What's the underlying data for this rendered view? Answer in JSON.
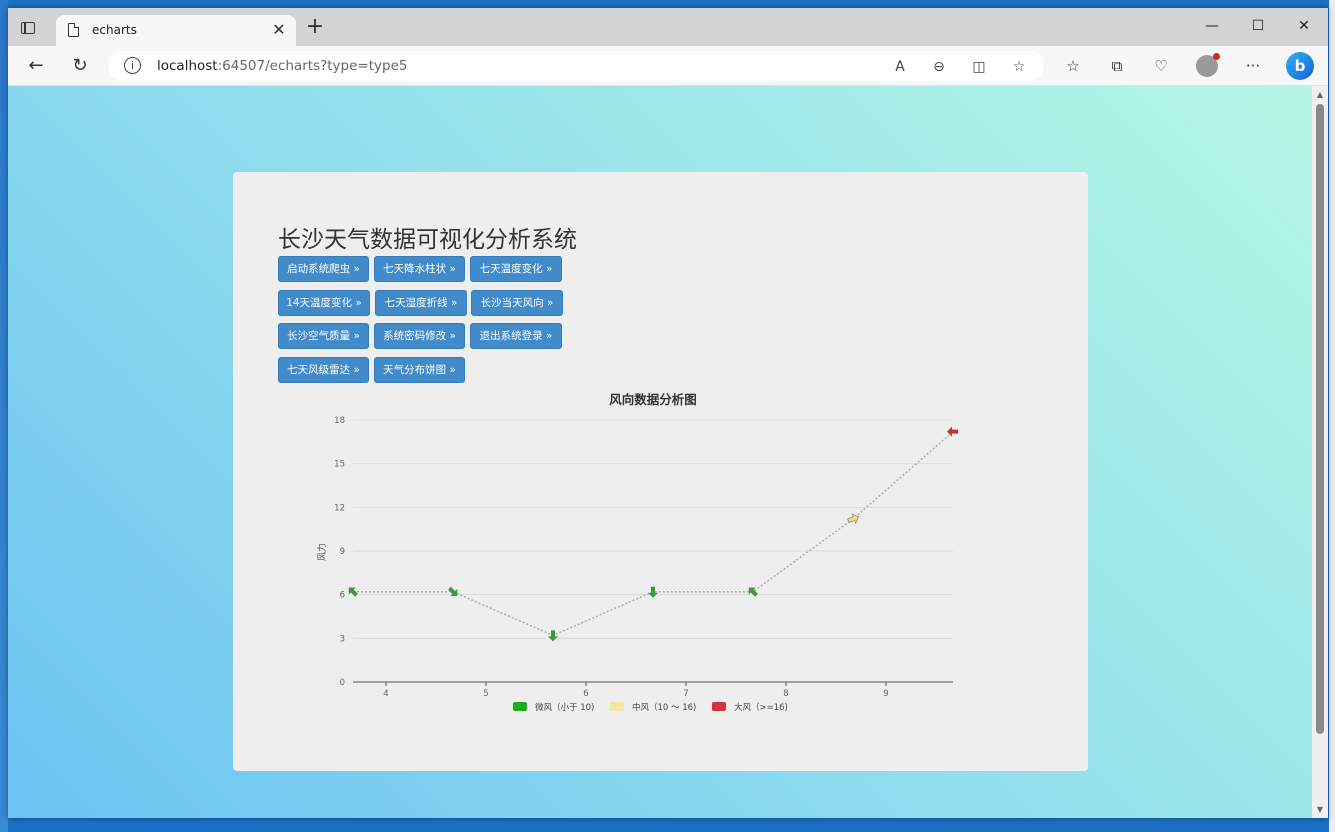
{
  "browser": {
    "tab_title": "echarts",
    "url_host": "localhost",
    "url_rest": ":64507/echarts?type=type5"
  },
  "page": {
    "title": "长沙天气数据可视化分析系统",
    "buttons": [
      "启动系统爬虫 »",
      "七天降水柱状 »",
      "七天温度变化 »",
      "14天温度变化 »",
      "七天湿度折线 »",
      "长沙当天风向 »",
      "长沙空气质量 »",
      "系统密码修改 »",
      "退出系统登录 »",
      "七天风级雷达 »",
      "天气分布饼图 »"
    ]
  },
  "chart_data": {
    "type": "line",
    "title": "风向数据分析图",
    "ylabel": "风力",
    "xlabel": "",
    "x_ticks": [
      "4",
      "5",
      "6",
      "7",
      "8",
      "9"
    ],
    "xlim": [
      3.67,
      9.67
    ],
    "ylim": [
      0,
      18
    ],
    "y_ticks": [
      "0",
      "3",
      "6",
      "9",
      "12",
      "15",
      "18"
    ],
    "grid": true,
    "points": [
      {
        "x": 3.67,
        "y": 6.2,
        "level": "weak",
        "dir": 225
      },
      {
        "x": 4.67,
        "y": 6.2,
        "level": "weak",
        "dir": 45
      },
      {
        "x": 5.67,
        "y": 3.2,
        "level": "weak",
        "dir": 90
      },
      {
        "x": 6.67,
        "y": 6.2,
        "level": "weak",
        "dir": 90
      },
      {
        "x": 7.67,
        "y": 6.2,
        "level": "weak",
        "dir": 225
      },
      {
        "x": 8.67,
        "y": 11.2,
        "level": "medium",
        "dir": 340
      },
      {
        "x": 9.67,
        "y": 17.2,
        "level": "strong",
        "dir": 180
      }
    ],
    "legend": [
      {
        "name": "微风（小于 10)",
        "color": "#1aad19"
      },
      {
        "name": "中风（10 ～ 16)",
        "color": "#f6e79e"
      },
      {
        "name": "大风（>=16)",
        "color": "#d0333c"
      }
    ],
    "legend_position": "bottom-center",
    "colors": {
      "weak": "#3b9a3b",
      "medium": "#e8d98a",
      "strong": "#c23531",
      "line": "#aaaaaa"
    }
  }
}
